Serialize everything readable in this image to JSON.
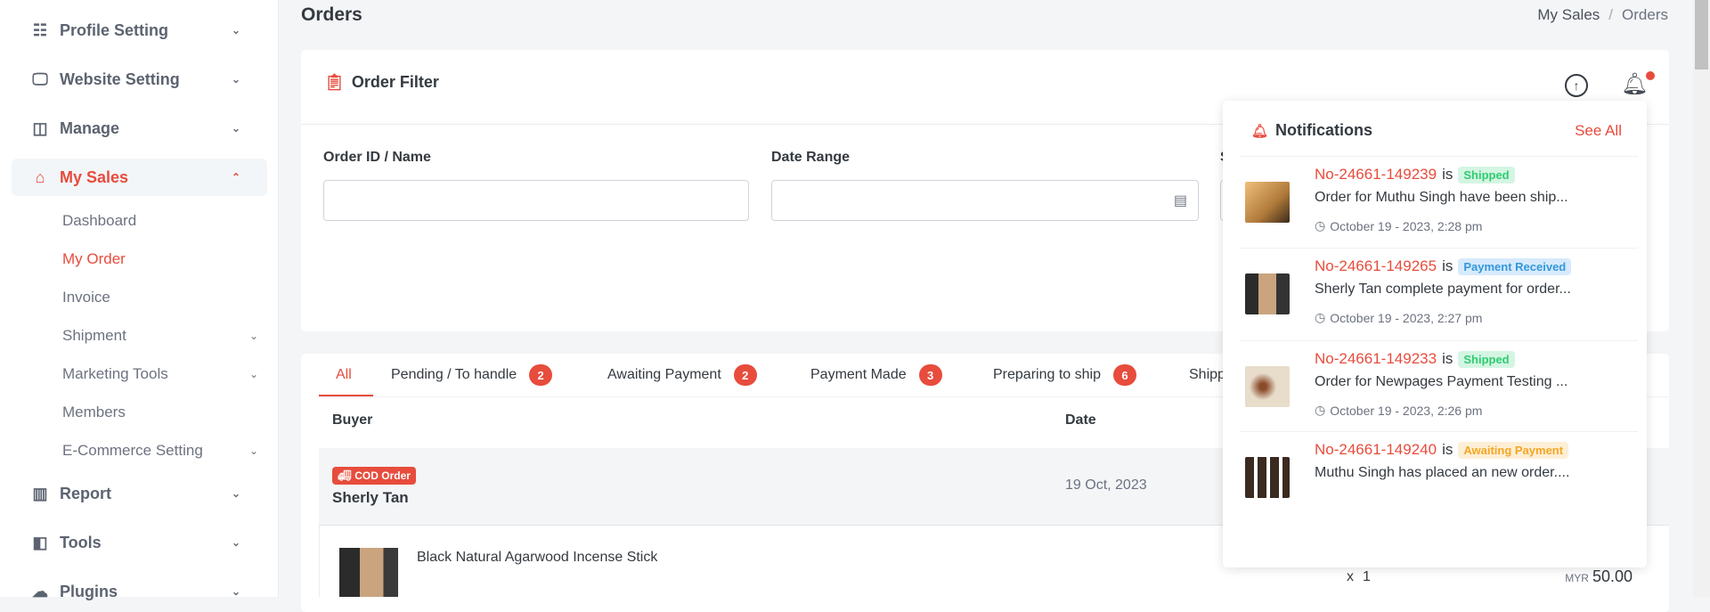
{
  "sidebar": {
    "items": [
      {
        "label": "Profile Setting",
        "icon": "profile-list-icon"
      },
      {
        "label": "Website Setting",
        "icon": "monitor-icon"
      },
      {
        "label": "Manage",
        "icon": "layout-icon"
      },
      {
        "label": "My Sales",
        "icon": "store-icon",
        "active": true
      },
      {
        "label": "Report",
        "icon": "chart-icon"
      },
      {
        "label": "Tools",
        "icon": "tools-icon"
      },
      {
        "label": "Plugins",
        "icon": "puzzle-icon"
      }
    ],
    "subitems": [
      {
        "label": "Dashboard"
      },
      {
        "label": "My Order",
        "active": true
      },
      {
        "label": "Invoice"
      },
      {
        "label": "Shipment",
        "has_children": true
      },
      {
        "label": "Marketing Tools",
        "has_children": true
      },
      {
        "label": "Members"
      },
      {
        "label": "E-Commerce Setting",
        "has_children": true
      }
    ]
  },
  "header": {
    "title": "Orders",
    "breadcrumb": [
      "My Sales",
      "Orders"
    ]
  },
  "filter": {
    "title": "Order Filter",
    "fields": [
      {
        "label": "Order ID / Name",
        "value": "",
        "placeholder": ""
      },
      {
        "label": "Date Range",
        "value": "",
        "placeholder": ""
      },
      {
        "label": "S"
      }
    ]
  },
  "tabs": [
    {
      "label": "All",
      "active": true
    },
    {
      "label": "Pending / To handle",
      "count": "2"
    },
    {
      "label": "Awaiting Payment",
      "count": "2"
    },
    {
      "label": "Payment Made",
      "count": "3"
    },
    {
      "label": "Preparing to ship",
      "count": "6"
    },
    {
      "label": "Shipp"
    }
  ],
  "table": {
    "columns": [
      "Buyer",
      "Date"
    ],
    "order": {
      "badge": "COD Order",
      "buyer": "Sherly Tan",
      "date": "19 Oct, 2023",
      "product": "Black Natural Agarwood Incense Stick",
      "qty_prefix": "x",
      "qty": "1",
      "currency": "MYR",
      "price": "50.00"
    }
  },
  "notifications": {
    "title": "Notifications",
    "see_all": "See All",
    "items": [
      {
        "id": "No-24661-149239",
        "is": "is",
        "status": "Shipped",
        "status_color": "#2ecc71",
        "desc": "Order for Muthu Singh have been ship...",
        "time": "October 19 - 2023, 2:28 pm"
      },
      {
        "id": "No-24661-149265",
        "is": "is",
        "status": "Payment Received",
        "status_color": "#3498db",
        "desc": "Sherly Tan complete payment for order...",
        "time": "October 19 - 2023, 2:27 pm"
      },
      {
        "id": "No-24661-149233",
        "is": "is",
        "status": "Shipped",
        "status_color": "#2ecc71",
        "desc": "Order for Newpages Payment Testing ...",
        "time": "October 19 - 2023, 2:26 pm"
      },
      {
        "id": "No-24661-149240",
        "is": "is",
        "status": "Awaiting Payment",
        "status_color": "#f5a623",
        "desc": "Muthu Singh has placed an new order....",
        "time": ""
      }
    ]
  },
  "colors": {
    "accent": "#e74c3c"
  }
}
